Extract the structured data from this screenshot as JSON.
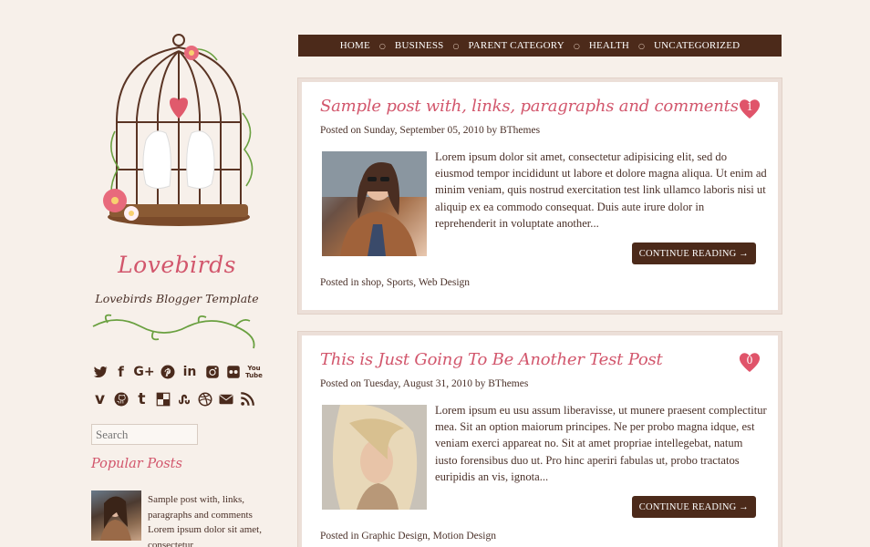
{
  "colors": {
    "accent": "#d2566c",
    "nav_bg": "#4c2a1a",
    "background": "#f7f0ea",
    "text": "#4a3028"
  },
  "blog": {
    "title": "Lovebirds",
    "description": "Lovebirds Blogger Template"
  },
  "social_icons": [
    "twitter-icon",
    "facebook-icon",
    "google-plus-icon",
    "pinterest-icon",
    "linkedin-icon",
    "instagram-icon",
    "flickr-icon",
    "youtube-icon",
    "vimeo-icon",
    "github-icon",
    "tumblr-icon",
    "delicious-icon",
    "stumbleupon-icon",
    "dribbble-icon",
    "email-icon",
    "rss-icon"
  ],
  "social_glyphs": {
    "facebook": "f",
    "google": "G+",
    "linkedin": "in",
    "vimeo": "v",
    "tumblr": "t",
    "youtube": "You\nTube"
  },
  "search": {
    "placeholder": "Search"
  },
  "popular": {
    "title": "Popular Posts",
    "items": [
      {
        "title": "Sample post with, links, paragraphs and comments",
        "snippet": "Lorem ipsum dolor sit amet, consectetur"
      }
    ]
  },
  "nav": {
    "items": [
      "HOME",
      "BUSINESS",
      "PARENT CATEGORY",
      "HEALTH",
      "UNCATEGORIZED"
    ]
  },
  "posts": [
    {
      "title": "Sample post with, links, paragraphs and comments",
      "comments": "1",
      "meta_prefix": "Posted on Sunday, September 05, 2010 by ",
      "author": "BThemes",
      "excerpt": "Lorem ipsum dolor sit amet, consectetur adipisicing elit, sed do eiusmod tempor incididunt ut labore et dolore magna aliqua. Ut enim ad minim veniam, quis nostrud exercitation test link ullamco laboris nisi ut aliquip ex ea commodo consequat. Duis aute irure dolor in reprehenderit in voluptate another...",
      "read_more": "CONTINUE READING →",
      "cats_prefix": "Posted in ",
      "cats": [
        "shop",
        "Sports",
        "Web Design"
      ]
    },
    {
      "title": "This is Just Going To Be Another Test Post",
      "comments": "0",
      "meta_prefix": "Posted on Tuesday, August 31, 2010 by ",
      "author": "BThemes",
      "excerpt": "Lorem ipsum eu usu assum liberavisse, ut munere praesent complectitur mea. Sit an option maiorum principes. Ne per probo magna idque, est veniam exerci appareat no. Sit at amet propriae intellegebat, natum iusto forensibus duo ut. Pro hinc aperiri fabulas ut, probo tractatos euripidis an vis, ignota...",
      "read_more": "CONTINUE READING →",
      "cats_prefix": "Posted in ",
      "cats": [
        "Graphic Design",
        "Motion Design"
      ]
    }
  ]
}
